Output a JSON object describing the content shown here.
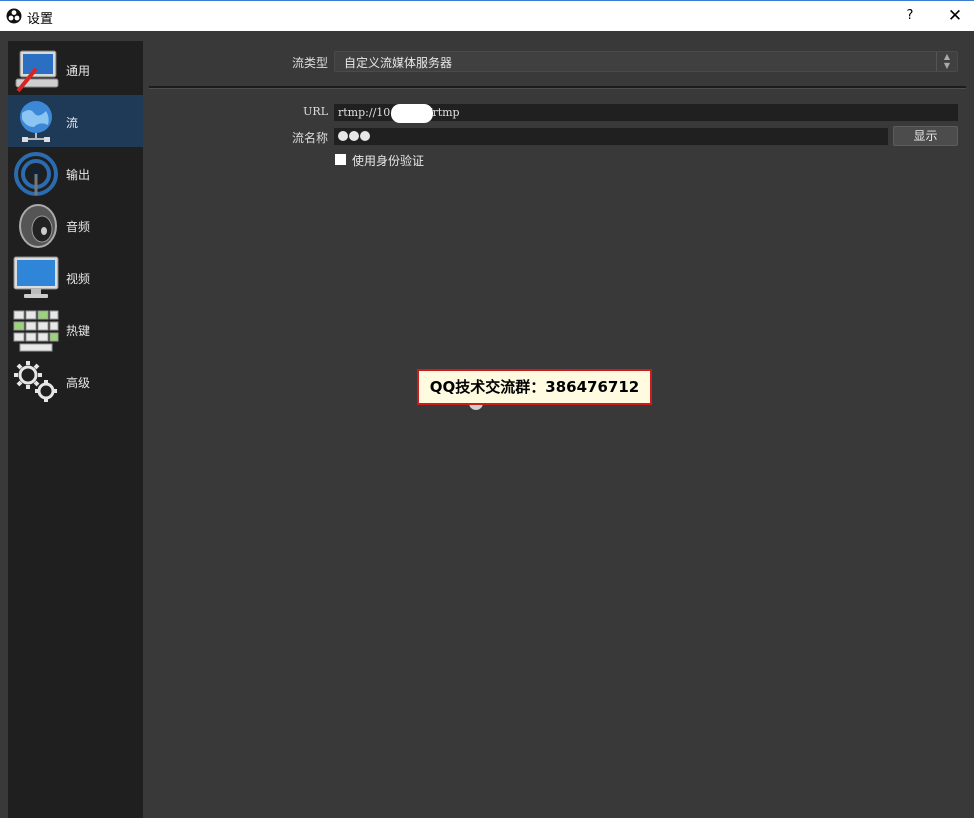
{
  "window": {
    "title": "设置",
    "help_label": "?",
    "close_label": "✕"
  },
  "sidebar": {
    "items": [
      {
        "label": "通用",
        "icon": "general-monitor-icon",
        "active": false
      },
      {
        "label": "流",
        "icon": "globe-network-icon",
        "active": true
      },
      {
        "label": "输出",
        "icon": "broadcast-output-icon",
        "active": false
      },
      {
        "label": "音频",
        "icon": "speaker-icon",
        "active": false
      },
      {
        "label": "视频",
        "icon": "monitor-icon",
        "active": false
      },
      {
        "label": "热键",
        "icon": "keyboard-icon",
        "active": false
      },
      {
        "label": "高级",
        "icon": "gears-icon",
        "active": false
      }
    ]
  },
  "stream": {
    "type_label": "流类型",
    "type_value": "自定义流媒体服务器",
    "url_label": "URL",
    "url_value": "rtmp://10        .2/rtmp",
    "key_label": "流名称",
    "show_button": "显示",
    "auth_checkbox_label": "使用身份验证",
    "auth_checked": false
  },
  "watermark": {
    "text": "QQ技术交流群：386476712"
  },
  "colors": {
    "sidebar_bg": "#1f1f1f",
    "active_item_bg": "#1f3a57",
    "panel_bg": "#3a3a3a",
    "watermark_border": "#cc1b1b"
  }
}
